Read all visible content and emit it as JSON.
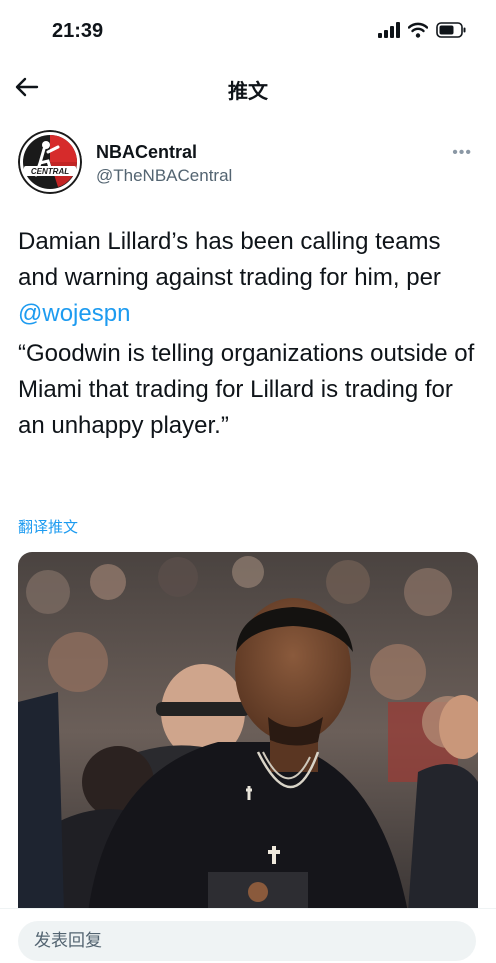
{
  "status_bar": {
    "time": "21:39"
  },
  "header": {
    "title": "推文"
  },
  "author": {
    "name": "NBACentral",
    "handle": "@TheNBACentral",
    "avatar_text": "CENTRAL"
  },
  "tweet": {
    "paragraph1_text": "Damian Lillard’s has been calling teams and warning against trading for him, per ",
    "mention": "@wojespn",
    "paragraph2": "“Goodwin is telling organizations outside of Miami that trading for Lillard is trading for an unhappy player.”"
  },
  "translate_label": "翻译推文",
  "reply": {
    "placeholder": "发表回复"
  },
  "colors": {
    "accent": "#1d9bf0",
    "text": "#0f1419",
    "secondary": "#536471"
  }
}
